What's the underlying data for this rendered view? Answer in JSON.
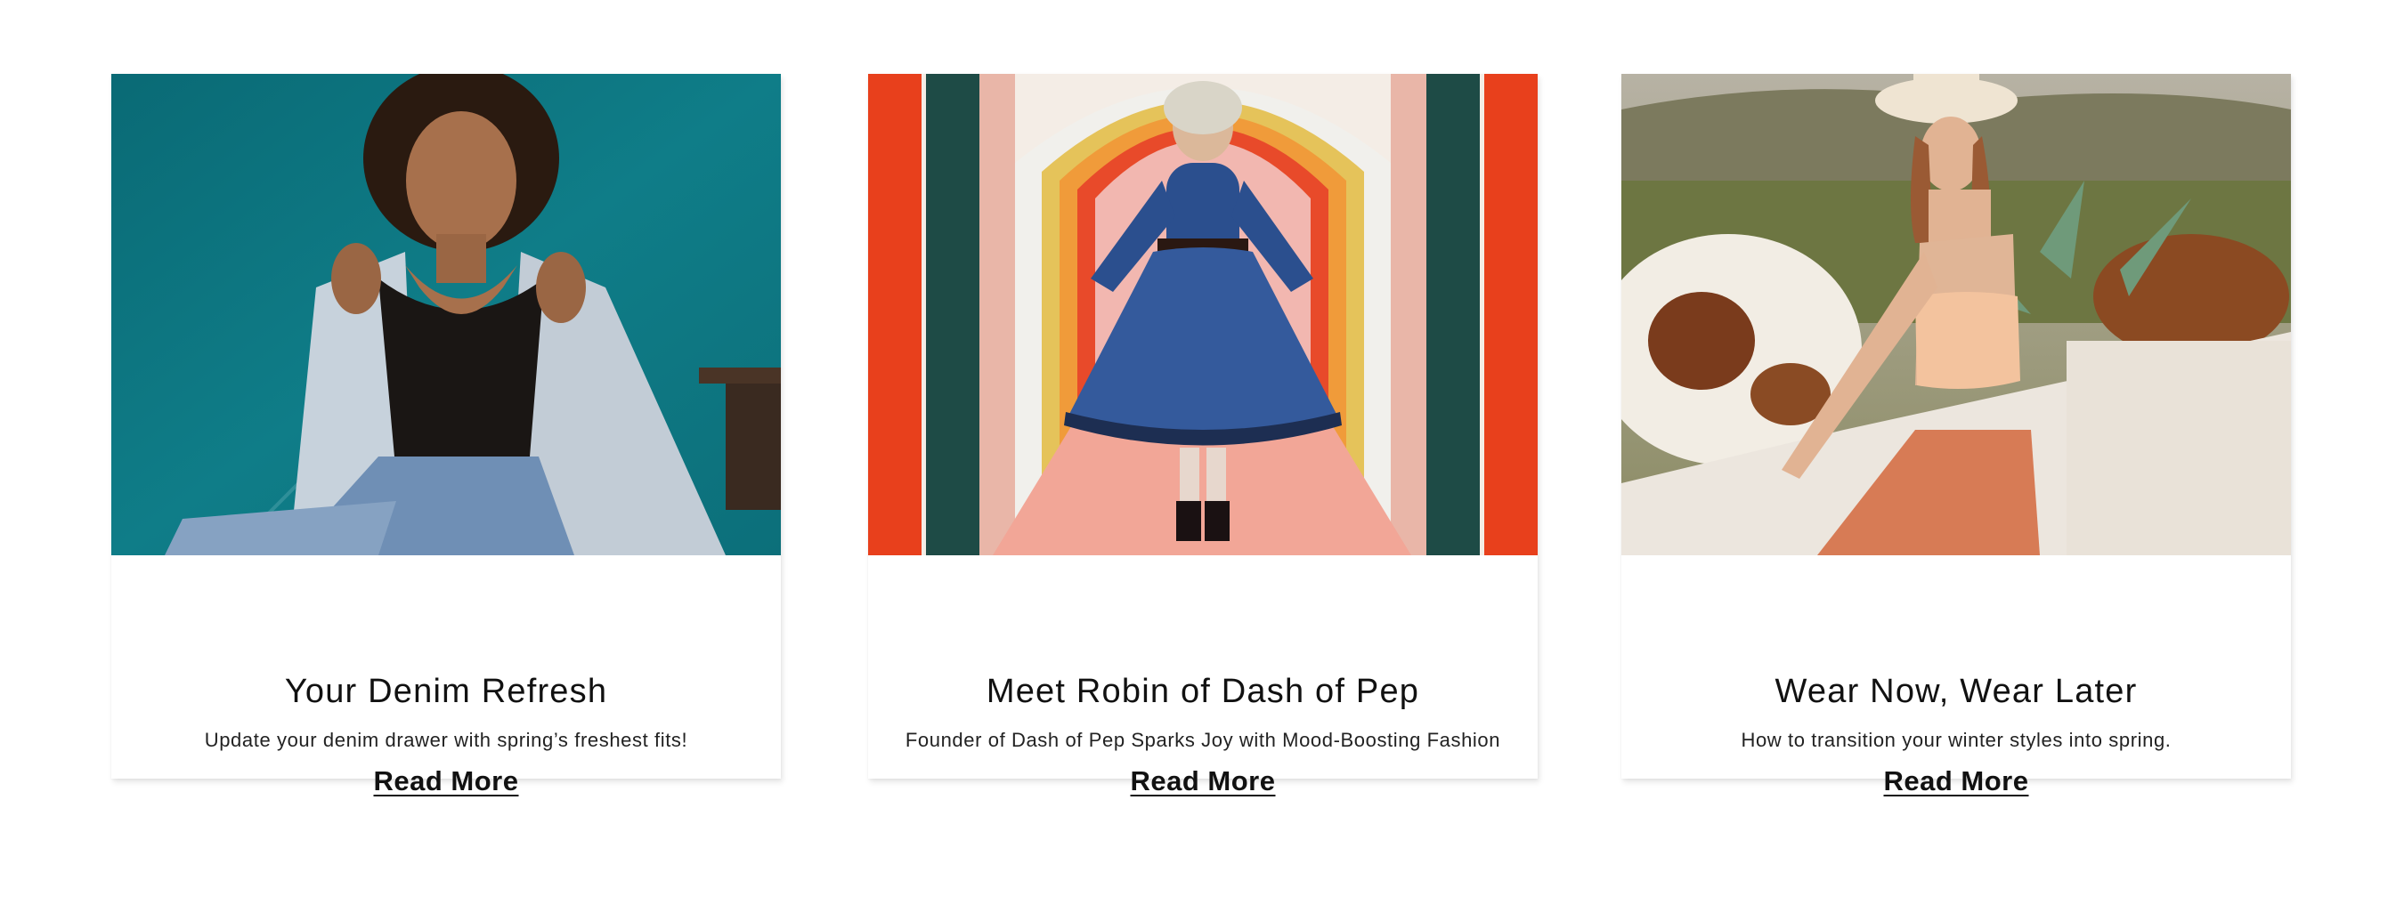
{
  "cards": [
    {
      "title": "Your Denim Refresh",
      "description": "Update your denim drawer with spring’s freshest fits!",
      "link_label": "Read More"
    },
    {
      "title": "Meet Robin of Dash of Pep",
      "description": "Founder of Dash of Pep Sparks Joy with Mood-Boosting Fashion",
      "link_label": "Read More"
    },
    {
      "title": "Wear Now, Wear Later",
      "description": "How to transition your winter styles into spring.",
      "link_label": "Read More"
    }
  ],
  "colors": {
    "text": "#111111",
    "background": "#ffffff",
    "teal_wall": "#0f7a85",
    "orange_arch": "#e8401c",
    "desert_wall": "#ece6de"
  }
}
